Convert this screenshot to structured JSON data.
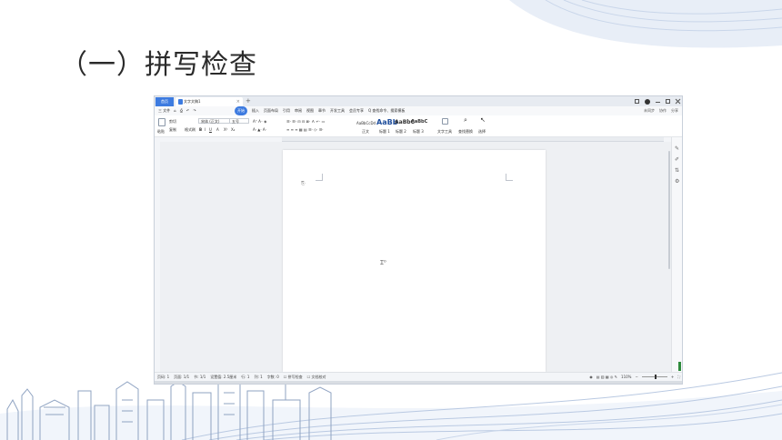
{
  "slide": {
    "title": "（一）拼写检查"
  },
  "window": {
    "home_tab": "首页",
    "doc_tab": "文字文稿1",
    "new_tab": "+"
  },
  "menubar": {
    "quick_access": [
      "三 文件",
      "⌂",
      "⎙",
      "↶",
      "↷"
    ],
    "tabs": [
      "开始",
      "插入",
      "页面布局",
      "引用",
      "审阅",
      "视图",
      "章节",
      "开发工具",
      "会员专享",
      "Q 查找命令、搜索模板"
    ],
    "active_tab": "开始",
    "right": [
      "未同步",
      "协作",
      "分享"
    ]
  },
  "ribbon": {
    "paste": "粘贴",
    "cut": "剪切",
    "copy": "复制",
    "format_painter": "格式刷",
    "font_name": "宋体 (正文)",
    "font_size": "五号",
    "styles": [
      {
        "sample": "AaBbCcDd",
        "label": "正文"
      },
      {
        "sample": "AaBb",
        "label": "标题 1"
      },
      {
        "sample": "AaBbC",
        "label": "标题 2"
      },
      {
        "sample": "AaBbC",
        "label": "标题 3"
      }
    ],
    "text_tools": "文字工具",
    "find_replace": "查找替换",
    "select": "选择"
  },
  "statusbar": {
    "items": [
      "页码: 1",
      "页面: 1/1",
      "节: 1/1",
      "设置值: 2.5厘米",
      "行: 1",
      "列: 1",
      "字数: 0",
      "☐ 拼写检查",
      "☐ 文档校对"
    ],
    "zoom": "110%"
  },
  "colors": {
    "accent": "#3d7be0",
    "deco_blue": "#dfe8f4",
    "deco_line": "#b9c9e2"
  }
}
